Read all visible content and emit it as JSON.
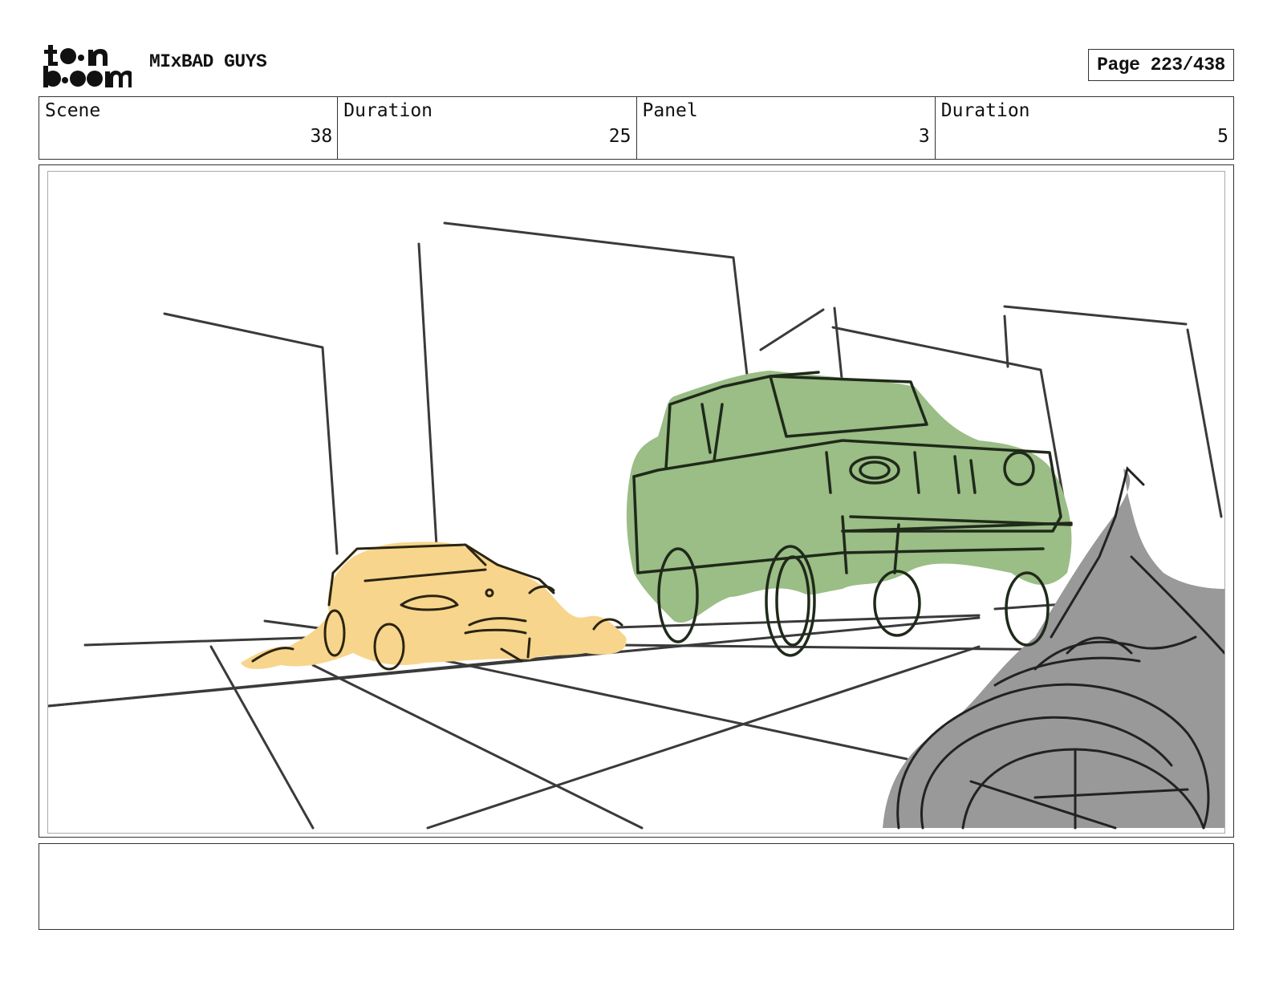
{
  "header": {
    "logo_label": "toon boom",
    "project_title": "MIxBAD GUYS",
    "page_label": "Page 223/438"
  },
  "info": {
    "scene_label": "Scene",
    "scene_value": "38",
    "scene_duration_label": "Duration",
    "scene_duration_value": "25",
    "panel_label": "Panel",
    "panel_value": "3",
    "panel_duration_label": "Duration",
    "panel_duration_value": "5"
  },
  "colors": {
    "car": "#f7d58c",
    "truck": "#9bbd86",
    "foreground": "#999999",
    "ink": "#2a2a2a"
  },
  "notes": {
    "text": ""
  }
}
